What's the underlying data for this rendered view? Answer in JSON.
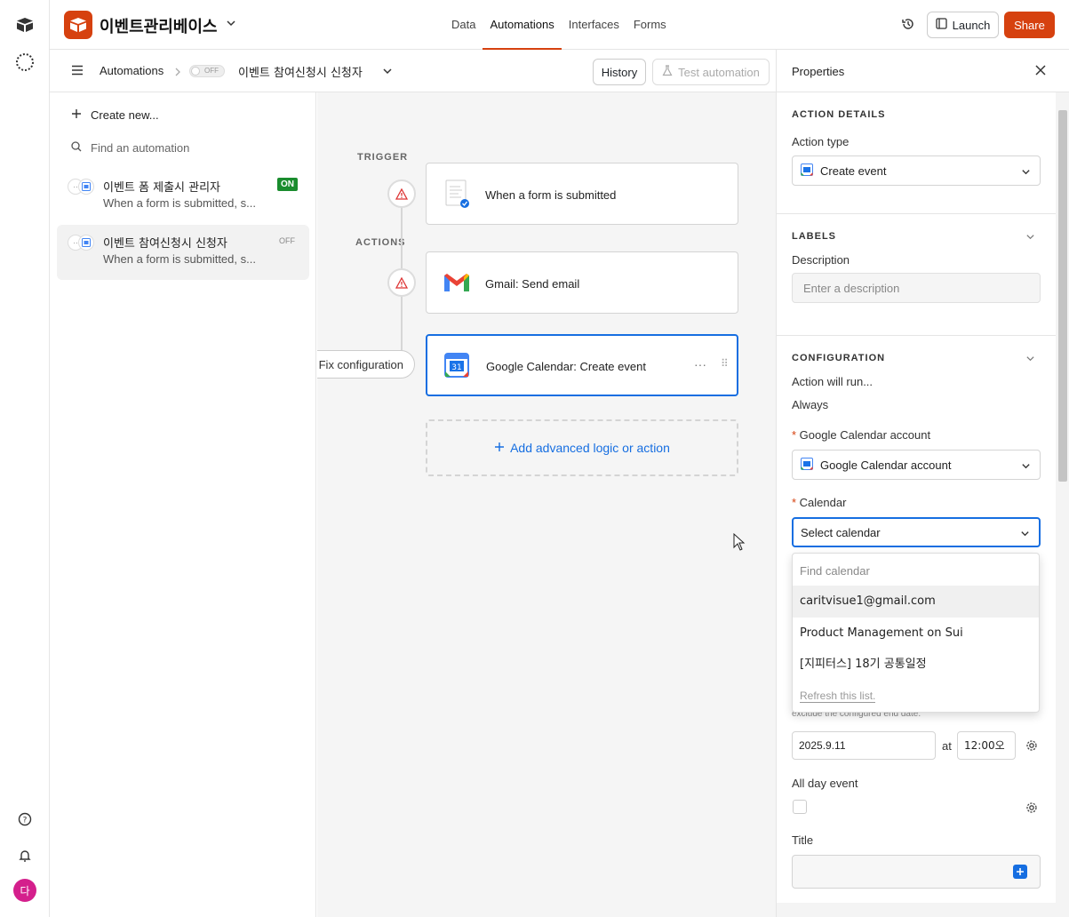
{
  "base": {
    "name": "이벤트관리베이스"
  },
  "nav": {
    "tabs": [
      {
        "label": "Data"
      },
      {
        "label": "Automations"
      },
      {
        "label": "Interfaces"
      },
      {
        "label": "Forms"
      }
    ]
  },
  "topbar": {
    "launch_label": "Launch",
    "share_label": "Share"
  },
  "subbar": {
    "breadcrumb": "Automations",
    "toggle_state": "OFF",
    "automation_title": "이벤트 참여신청시 신청자",
    "history_label": "History",
    "test_label": "Test automation"
  },
  "sidebar": {
    "create_new": "Create new...",
    "find_placeholder": "Find an automation",
    "automations": [
      {
        "name": "이벤트 폼 제출시 관리자",
        "subtitle": "When a form is submitted, s...",
        "status": "ON"
      },
      {
        "name": "이벤트 참여신청시 신청자",
        "subtitle": "When a form is submitted, s...",
        "status": "OFF"
      }
    ]
  },
  "canvas": {
    "trigger_label": "TRIGGER",
    "actions_label": "ACTIONS",
    "steps": [
      {
        "label": "When a form is submitted"
      },
      {
        "label": "Gmail: Send email"
      },
      {
        "label": "Google Calendar: Create event"
      }
    ],
    "fix_label": "Fix configuration",
    "add_label": "Add advanced logic or action"
  },
  "properties": {
    "title": "Properties",
    "action_details": {
      "heading": "ACTION DETAILS",
      "action_type_label": "Action type",
      "action_type_value": "Create event"
    },
    "labels": {
      "heading": "LABELS",
      "description_label": "Description",
      "description_placeholder": "Enter a description"
    },
    "configuration": {
      "heading": "CONFIGURATION",
      "run_label": "Action will run...",
      "run_value": "Always",
      "account_label": "Google Calendar account",
      "account_value": "Google Calendar account",
      "calendar_label": "Calendar",
      "calendar_value": "Select calendar",
      "dropdown": {
        "find_placeholder": "Find calendar",
        "options": [
          "caritvisue1@gmail.com",
          "Product Management on Sui",
          "[지피터스] 18기 공통일정"
        ],
        "refresh_label": "Refresh this list."
      },
      "hint": "exclude the configured end date.",
      "date_value": "2025.9.11",
      "at_label": "at",
      "time_value": "12:00오",
      "all_day_label": "All day event",
      "title_label": "Title"
    }
  },
  "colors": {
    "accent": "#d6410f",
    "primary_blue": "#166ee1",
    "on_green": "#1a8c2e"
  },
  "user": {
    "avatar_initial": "다"
  }
}
